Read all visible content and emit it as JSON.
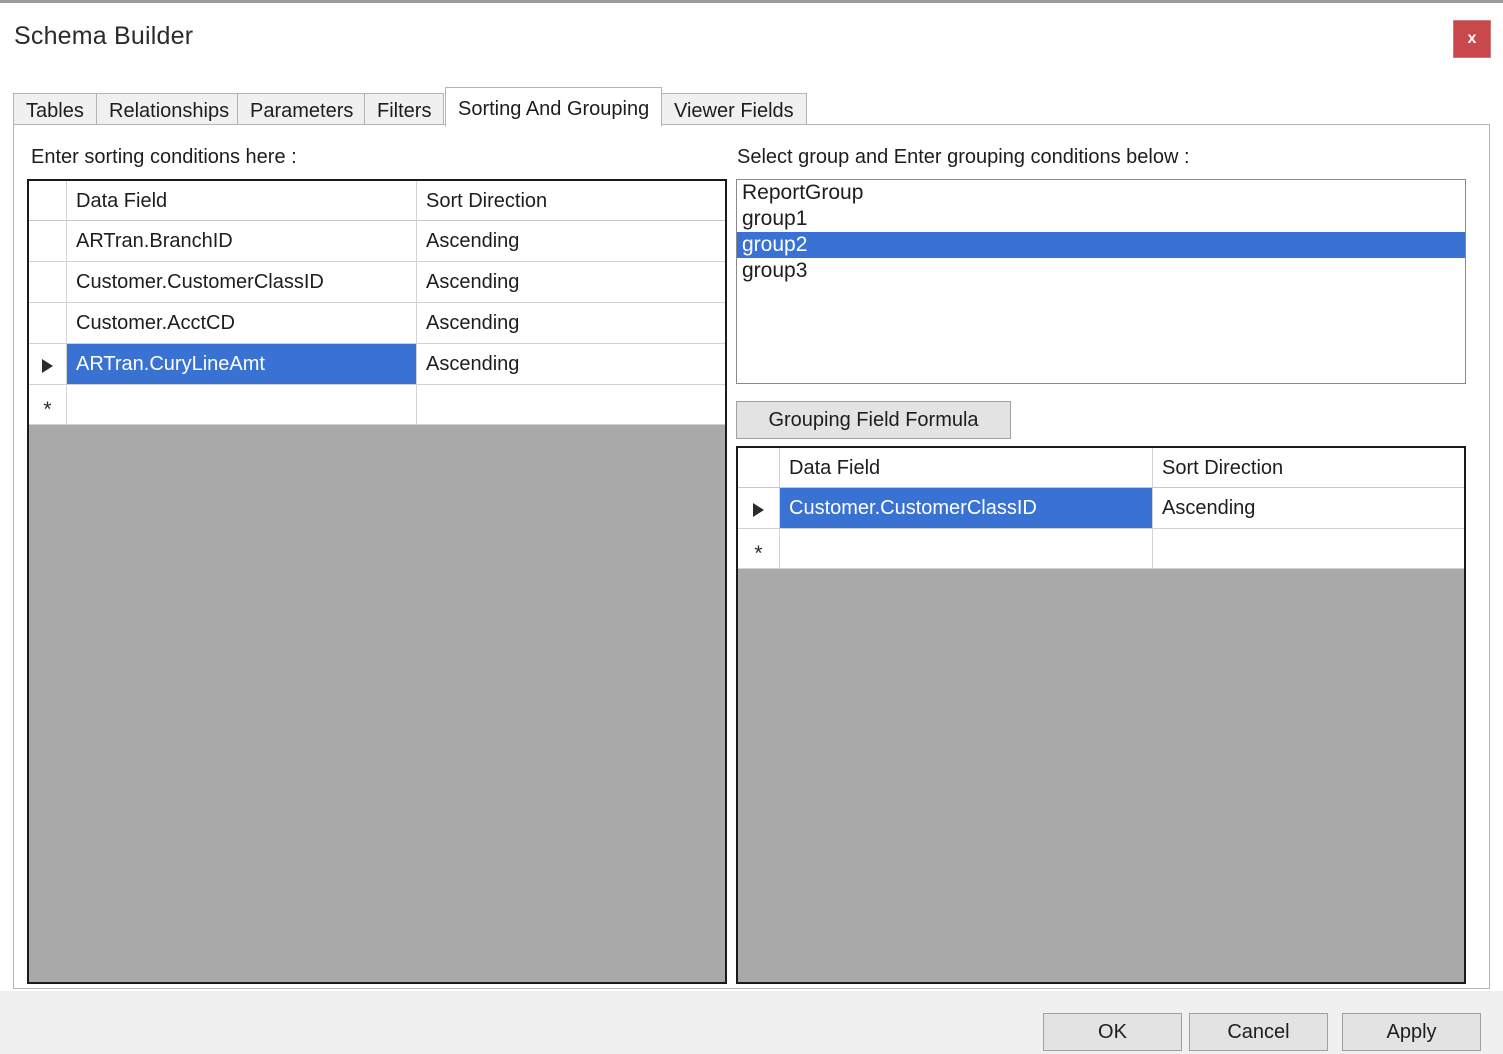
{
  "window": {
    "title": "Schema Builder",
    "close_label": "x",
    "close_icon": "close-icon"
  },
  "tabs": [
    {
      "label": "Tables",
      "active": false
    },
    {
      "label": "Relationships",
      "active": false
    },
    {
      "label": "Parameters",
      "active": false
    },
    {
      "label": "Filters",
      "active": false
    },
    {
      "label": "Sorting And Grouping",
      "active": true
    },
    {
      "label": "Viewer Fields",
      "active": false
    }
  ],
  "sorting_panel": {
    "label": "Enter sorting conditions here :",
    "columns": [
      "Data Field",
      "Sort Direction"
    ],
    "rows": [
      {
        "field": "ARTran.BranchID",
        "direction": "Ascending",
        "selected": false,
        "current": false
      },
      {
        "field": "Customer.CustomerClassID",
        "direction": "Ascending",
        "selected": false,
        "current": false
      },
      {
        "field": "Customer.AcctCD",
        "direction": "Ascending",
        "selected": false,
        "current": false
      },
      {
        "field": "ARTran.CuryLineAmt",
        "direction": "Ascending",
        "selected": true,
        "current": true
      }
    ],
    "new_row_marker": "*"
  },
  "grouping_panel": {
    "label": "Select group and Enter grouping conditions below :",
    "groups": [
      {
        "label": "ReportGroup",
        "selected": false
      },
      {
        "label": "group1",
        "selected": false
      },
      {
        "label": "group2",
        "selected": true
      },
      {
        "label": "group3",
        "selected": false
      }
    ],
    "formula_button": "Grouping Field Formula",
    "columns": [
      "Data Field",
      "Sort Direction"
    ],
    "rows": [
      {
        "field": "Customer.CustomerClassID",
        "direction": "Ascending",
        "selected": true,
        "current": true
      }
    ],
    "new_row_marker": "*"
  },
  "footer": {
    "ok": "OK",
    "cancel": "Cancel",
    "apply": "Apply"
  },
  "colors": {
    "selection_blue": "#3a72d4",
    "grid_filler_gray": "#a9a9a9",
    "close_red": "#c9484b",
    "panel_bg": "#ffffff",
    "footer_bg": "#f0f0f0"
  }
}
